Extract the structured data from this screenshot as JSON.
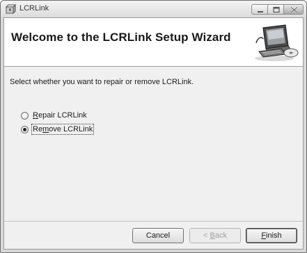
{
  "window": {
    "title": "LCRLink"
  },
  "banner": {
    "heading": "Welcome to the LCRLink Setup Wizard",
    "art_icon": "computer-with-disc-icon"
  },
  "body": {
    "prompt": "Select whether you want to repair or remove LCRLink.",
    "options": [
      {
        "mnemonic": "R",
        "rest": "epair LCRLink",
        "selected": false
      },
      {
        "pre": "Re",
        "mnemonic": "m",
        "rest": "ove LCRLink",
        "selected": true
      }
    ]
  },
  "buttons": {
    "cancel": {
      "label": "Cancel"
    },
    "back": {
      "prefix": "< ",
      "mnemonic": "B",
      "rest": "ack",
      "enabled": false
    },
    "finish": {
      "mnemonic": "F",
      "rest": "inish"
    }
  },
  "icons": {
    "app": "setup-package-icon",
    "minimize": "minimize-icon",
    "maximize": "maximize-icon",
    "close": "close-icon"
  }
}
